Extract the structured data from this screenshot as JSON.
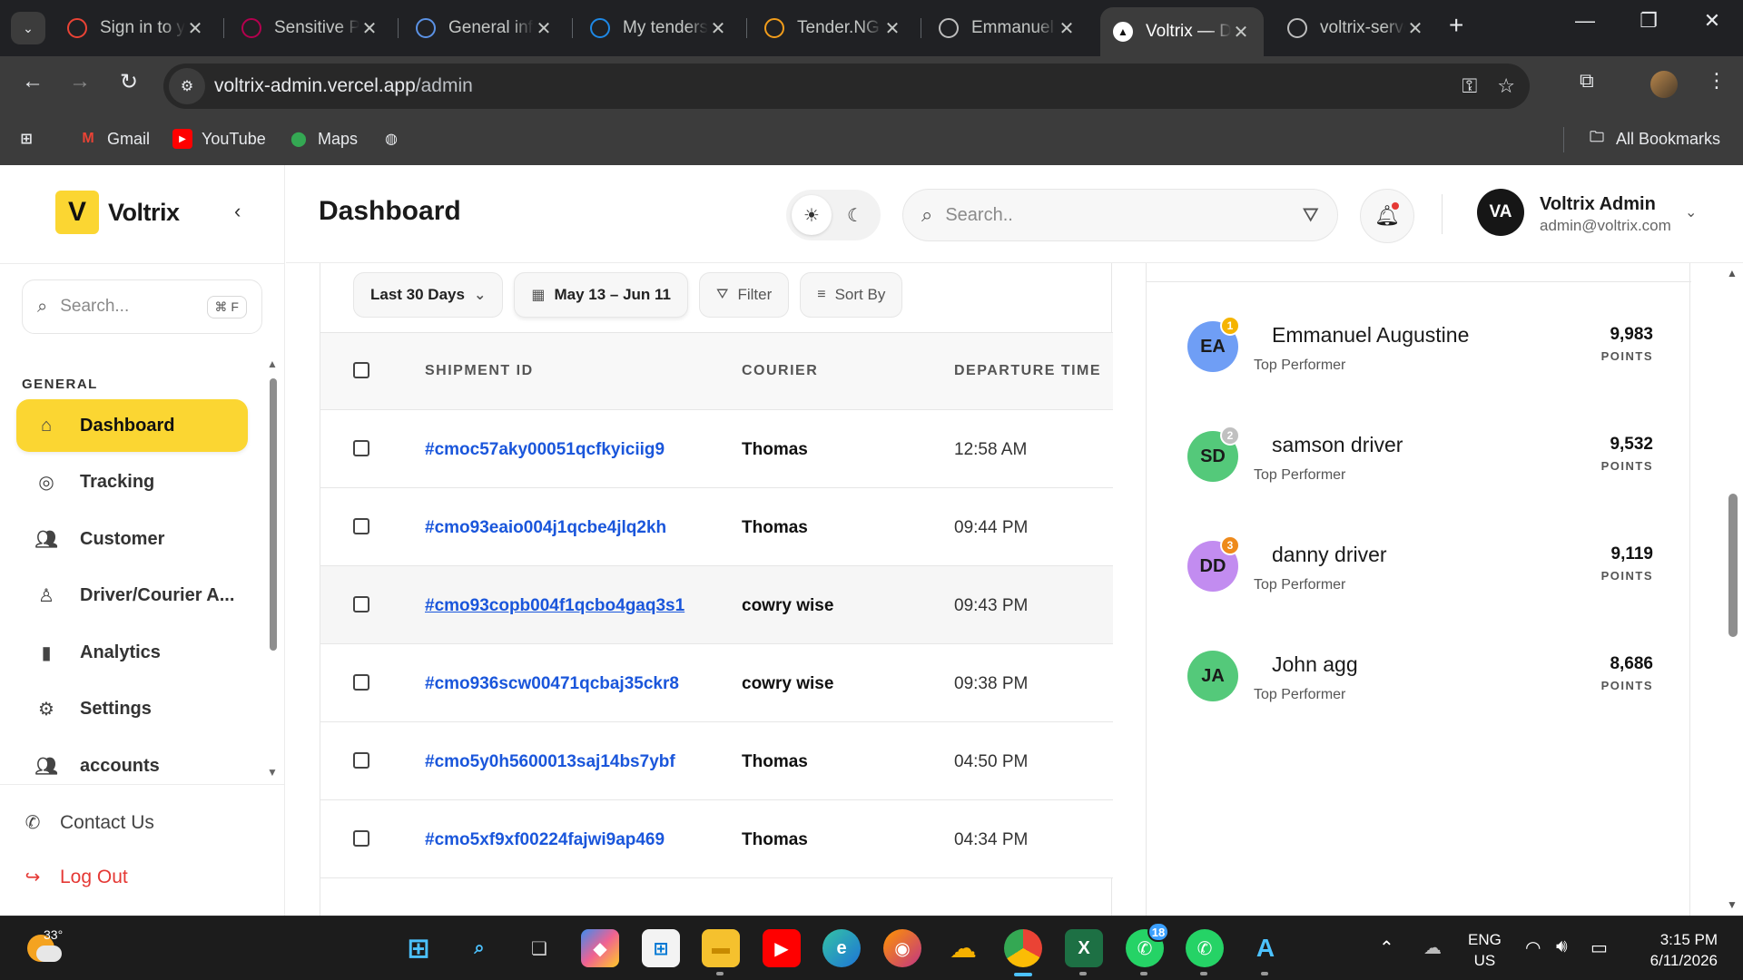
{
  "browser": {
    "tabs": [
      {
        "title": "Sign in to your account",
        "icon": "gmail-icon",
        "color": "#ea4335"
      },
      {
        "title": "Sensitive Publications",
        "icon": "sensitive-icon",
        "color": "#b4004e"
      },
      {
        "title": "General information",
        "icon": "un-icon",
        "color": "#5b92e5"
      },
      {
        "title": "My tenders",
        "icon": "tender-globe-icon",
        "color": "#1e88e5"
      },
      {
        "title": "Tender.NG",
        "icon": "tenderng-icon",
        "color": "#f29d1b"
      },
      {
        "title": "Emmanuel",
        "icon": "globe-icon",
        "color": "#bdbdbd"
      },
      {
        "title": "Voltrix — Dashboard",
        "icon": "voltrix-tab-icon",
        "color": "#ffffff"
      },
      {
        "title": "voltrix-server",
        "icon": "globe-icon",
        "color": "#bdbdbd"
      }
    ],
    "url_host": "voltrix-admin.vercel.app",
    "url_path": "/admin",
    "bookmarks": [
      {
        "label": "Gmail",
        "icon": "gmail-icon"
      },
      {
        "label": "YouTube",
        "icon": "youtube-icon"
      },
      {
        "label": "Maps",
        "icon": "maps-icon"
      }
    ],
    "all_bookmarks_label": "All Bookmarks"
  },
  "sidebar": {
    "brand": "Voltrix",
    "search_placeholder": "Search...",
    "search_shortcut": "⌘ F",
    "section_label": "GENERAL",
    "items": [
      {
        "label": "Dashboard",
        "icon": "home-icon",
        "active": true
      },
      {
        "label": "Tracking",
        "icon": "location-pin-icon"
      },
      {
        "label": "Customer",
        "icon": "users-icon"
      },
      {
        "label": "Driver/Courier A...",
        "icon": "person-icon"
      },
      {
        "label": "Analytics",
        "icon": "bar-chart-icon"
      },
      {
        "label": "Settings",
        "icon": "gear-icon"
      },
      {
        "label": "accounts",
        "icon": "accounts-icon"
      }
    ],
    "contact_label": "Contact Us",
    "logout_label": "Log Out"
  },
  "header": {
    "title": "Dashboard",
    "search_placeholder": "Search..",
    "user_initials": "VA",
    "user_name": "Voltrix Admin",
    "user_email": "admin@voltrix.com"
  },
  "filters": {
    "range_label": "Last 30 Days",
    "date_label": "May 13 – Jun 11",
    "filter_label": "Filter",
    "sort_label": "Sort By"
  },
  "table": {
    "columns": [
      "SHIPMENT ID",
      "COURIER",
      "DEPARTURE TIME"
    ],
    "rows": [
      {
        "id": "#cmoc57aky00051qcfkyiciig9",
        "courier": "Thomas",
        "time": "12:58 AM"
      },
      {
        "id": "#cmo93eaio004j1qcbe4jlq2kh",
        "courier": "Thomas",
        "time": "09:44 PM"
      },
      {
        "id": "#cmo93copb004f1qcbo4gaq3s1",
        "courier": "cowry wise",
        "time": "09:43 PM"
      },
      {
        "id": "#cmo936scw00471qcbaj35ckr8",
        "courier": "cowry wise",
        "time": "09:38 PM"
      },
      {
        "id": "#cmo5y0h5600013saj14bs7ybf",
        "courier": "Thomas",
        "time": "04:50 PM"
      },
      {
        "id": "#cmo5xf9xf00224fajwi9ap469",
        "courier": "Thomas",
        "time": "04:34 PM"
      }
    ]
  },
  "leaderboard": {
    "points_label": "POINTS",
    "entries": [
      {
        "initials": "EA",
        "name": "Emmanuel Augustine",
        "subtitle": "Top Performer",
        "points": "9,983",
        "rank": "1",
        "avatar_color": "#6f9ef5",
        "rank_color": "#f5b400"
      },
      {
        "initials": "SD",
        "name": "samson driver",
        "subtitle": "Top Performer",
        "points": "9,532",
        "rank": "2",
        "avatar_color": "#54c97a",
        "rank_color": "#c0c0c0"
      },
      {
        "initials": "DD",
        "name": "danny driver",
        "subtitle": "Top Performer",
        "points": "9,119",
        "rank": "3",
        "avatar_color": "#c28cf0",
        "rank_color": "#ee8a1c"
      },
      {
        "initials": "JA",
        "name": "John agg",
        "subtitle": "Top Performer",
        "points": "8,686",
        "rank": "",
        "avatar_color": "#54c97a",
        "rank_color": ""
      }
    ]
  },
  "taskbar": {
    "temperature": "33°",
    "whatsapp_badge": "18",
    "lang_line1": "ENG",
    "lang_line2": "US",
    "time": "3:15 PM",
    "date": "6/11/2026"
  },
  "colors": {
    "accent": "#fbd632",
    "link": "#1a56db",
    "danger": "#e53935"
  }
}
